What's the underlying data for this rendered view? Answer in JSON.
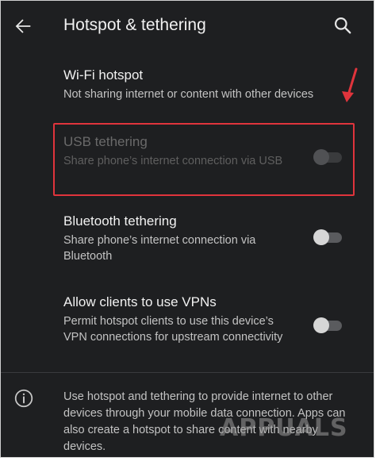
{
  "appbar": {
    "title": "Hotspot & tethering",
    "back_icon": "arrow-left-icon",
    "search_icon": "search-icon"
  },
  "settings": [
    {
      "title": "Wi-Fi hotspot",
      "subtitle": "Not sharing internet or content with other devices",
      "has_toggle": false,
      "enabled": true
    },
    {
      "title": "USB tethering",
      "subtitle": "Share phone’s internet connection via USB",
      "has_toggle": true,
      "toggle_on": false,
      "enabled": false
    },
    {
      "title": "Bluetooth tethering",
      "subtitle": "Share phone’s internet connection via Bluetooth",
      "has_toggle": true,
      "toggle_on": false,
      "enabled": true
    },
    {
      "title": "Allow clients to use VPNs",
      "subtitle": "Permit hotspot clients to use this device’s VPN connections for upstream connectivity",
      "has_toggle": true,
      "toggle_on": false,
      "enabled": true
    }
  ],
  "footer": {
    "icon": "info-icon",
    "text": "Use hotspot and tethering to provide internet to other devices through your mobile data connection. Apps can also create a hotspot to share content with nearby devices."
  },
  "annotations": {
    "highlight_color": "#e0343c",
    "arrow_color": "#e0343c"
  },
  "watermark": {
    "text": "APPUALS"
  },
  "colors": {
    "background": "#1e1f21",
    "text_primary": "#f1f1f1",
    "text_secondary": "#c3c3c3",
    "text_disabled": "#6a6a6a"
  }
}
